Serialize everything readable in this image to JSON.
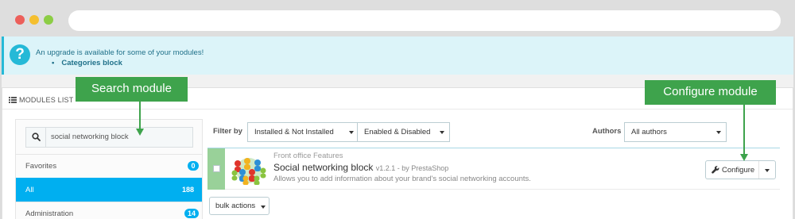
{
  "alert": {
    "icon": "question-icon",
    "icon_glyph": "?",
    "message": "An upgrade is available for some of your modules!",
    "module_link": "Categories block"
  },
  "panel": {
    "heading": "MODULES LIST",
    "heading_icon": "list-icon"
  },
  "search": {
    "icon": "search-icon",
    "value": "social networking block"
  },
  "categories": [
    {
      "label": "Favorites",
      "count": "0"
    },
    {
      "label": "All",
      "count": "188"
    },
    {
      "label": "Administration",
      "count": "14"
    }
  ],
  "filters": {
    "label": "Filter by",
    "installed": "Installed & Not Installed",
    "enabled": "Enabled & Disabled",
    "authors_label": "Authors",
    "authors": "All authors"
  },
  "module": {
    "category": "Front office Features",
    "name": "Social networking block",
    "version": "v1.2.1 - by PrestaShop",
    "description": "Allows you to add information about your brand's social networking accounts.",
    "configure_label": "Configure",
    "configure_icon": "wrench-icon"
  },
  "bulk": {
    "label": "bulk actions"
  },
  "callouts": {
    "search": "Search module",
    "configure": "Configure module"
  },
  "colors": {
    "accent": "#00aff0",
    "callout": "#3ea34c",
    "alert_bg": "#dcf4f9",
    "row_enabled": "#99d199"
  }
}
